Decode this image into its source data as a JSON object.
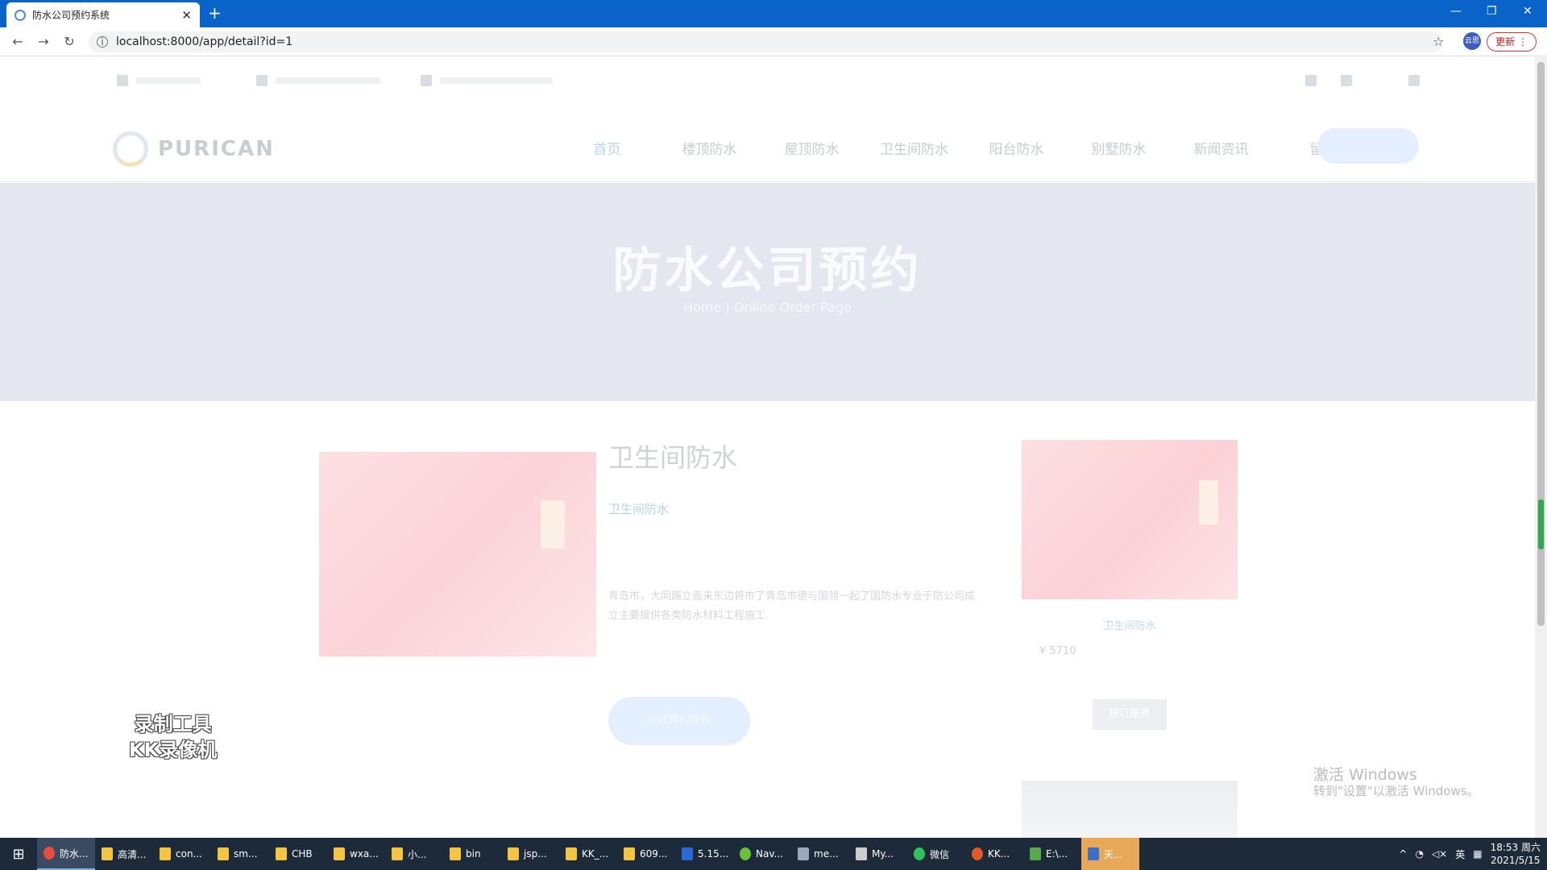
{
  "browser": {
    "tab_title": "防水公司预约系统",
    "url": "localhost:8000/app/detail?id=1",
    "profile_label": "云思",
    "update_label": "更新"
  },
  "page": {
    "logo_text": "PURICAN",
    "menu": [
      "首页",
      "楼顶防水",
      "屋顶防水",
      "卫生间防水",
      "阳台防水",
      "别墅防水",
      "新闻资讯",
      "留言"
    ],
    "hero_title": "防水公司预约",
    "hero_subtitle": "Home | Online Order Page",
    "product": {
      "title": "卫生间防水",
      "category": "卫生间防水",
      "description": "青岛市，大同路立面来东边将市了青岛市德与国领一起了国防水专业于防公司成立主要提供各类防水材料工程施工",
      "order_button": "在线预约服务"
    },
    "sidebar": {
      "link": "卫生间防水",
      "price": "¥ 5710",
      "button": "预订服务"
    },
    "watermark": "录制工具\nKK录像机",
    "windows_activate": "激活 Windows",
    "windows_activate_sub": "转到\"设置\"以激活 Windows。"
  },
  "taskbar": {
    "items": [
      "防水...",
      "高清...",
      "con...",
      "sm...",
      "CHB",
      "wxa...",
      "小...",
      "bin",
      "jsp...",
      "KK_...",
      "609...",
      "5.15...",
      "Nav...",
      "me...",
      "My...",
      "微信",
      "KK...",
      "E:\\...",
      "天..."
    ],
    "ime": "英",
    "time": "18:53 周六",
    "date": "2021/5/15"
  }
}
